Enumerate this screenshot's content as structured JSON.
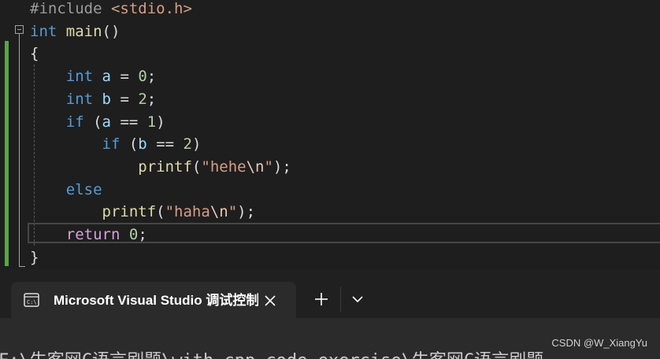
{
  "editor": {
    "lines": [
      [
        {
          "t": "#include ",
          "c": "pp"
        },
        {
          "t": "<stdio.h>",
          "c": "inc"
        }
      ],
      [
        {
          "t": "int",
          "c": "kw"
        },
        {
          "t": " ",
          "c": "pl"
        },
        {
          "t": "main",
          "c": "fn"
        },
        {
          "t": "()",
          "c": "pl"
        }
      ],
      [
        {
          "t": "{",
          "c": "pl"
        }
      ],
      [
        {
          "t": "    ",
          "c": "pl"
        },
        {
          "t": "int",
          "c": "kw"
        },
        {
          "t": " ",
          "c": "pl"
        },
        {
          "t": "a",
          "c": "var"
        },
        {
          "t": " = ",
          "c": "pl"
        },
        {
          "t": "0",
          "c": "num"
        },
        {
          "t": ";",
          "c": "pl"
        }
      ],
      [
        {
          "t": "    ",
          "c": "pl"
        },
        {
          "t": "int",
          "c": "kw"
        },
        {
          "t": " ",
          "c": "pl"
        },
        {
          "t": "b",
          "c": "var"
        },
        {
          "t": " = ",
          "c": "pl"
        },
        {
          "t": "2",
          "c": "num"
        },
        {
          "t": ";",
          "c": "pl"
        }
      ],
      [
        {
          "t": "    ",
          "c": "pl"
        },
        {
          "t": "if",
          "c": "kw"
        },
        {
          "t": " (",
          "c": "pl"
        },
        {
          "t": "a",
          "c": "var"
        },
        {
          "t": " == ",
          "c": "pl"
        },
        {
          "t": "1",
          "c": "num"
        },
        {
          "t": ")",
          "c": "pl"
        }
      ],
      [
        {
          "t": "        ",
          "c": "pl"
        },
        {
          "t": "if",
          "c": "kw"
        },
        {
          "t": " (",
          "c": "pl"
        },
        {
          "t": "b",
          "c": "var"
        },
        {
          "t": " == ",
          "c": "pl"
        },
        {
          "t": "2",
          "c": "num"
        },
        {
          "t": ")",
          "c": "pl"
        }
      ],
      [
        {
          "t": "            ",
          "c": "pl"
        },
        {
          "t": "printf",
          "c": "fn"
        },
        {
          "t": "(",
          "c": "pl"
        },
        {
          "t": "\"hehe",
          "c": "str"
        },
        {
          "t": "\\n",
          "c": "esc"
        },
        {
          "t": "\"",
          "c": "str"
        },
        {
          "t": ");",
          "c": "pl"
        }
      ],
      [
        {
          "t": "    ",
          "c": "pl"
        },
        {
          "t": "else",
          "c": "kw"
        }
      ],
      [
        {
          "t": "        ",
          "c": "pl"
        },
        {
          "t": "printf",
          "c": "fn"
        },
        {
          "t": "(",
          "c": "pl"
        },
        {
          "t": "\"haha",
          "c": "str"
        },
        {
          "t": "\\n",
          "c": "esc"
        },
        {
          "t": "\"",
          "c": "str"
        },
        {
          "t": ");",
          "c": "pl"
        }
      ],
      [
        {
          "t": "    ",
          "c": "pl"
        },
        {
          "t": "return",
          "c": "ctl"
        },
        {
          "t": " ",
          "c": "pl"
        },
        {
          "t": "0",
          "c": "num"
        },
        {
          "t": ";",
          "c": "pl"
        }
      ],
      [
        {
          "t": "}",
          "c": "pl"
        }
      ]
    ]
  },
  "terminal": {
    "tab_title": "Microsoft Visual Studio 调试控制台",
    "tab_icon": "console-icon",
    "close_icon": "close-icon",
    "new_tab_icon": "plus-icon",
    "dropdown_icon": "chevron-down-icon",
    "output_partial": "F:\\牛客网C语言刷题\\with_cpp_code_exercise\\牛客网C语言刷题"
  },
  "watermark": "CSDN @W_XiangYu",
  "colors": {
    "keyword": "#569cd6",
    "function": "#dcdcaa",
    "variable": "#9cdcfe",
    "number": "#b5cea8",
    "string": "#d69d85",
    "control": "#d8a0df",
    "change_bar": "#57a64a"
  }
}
